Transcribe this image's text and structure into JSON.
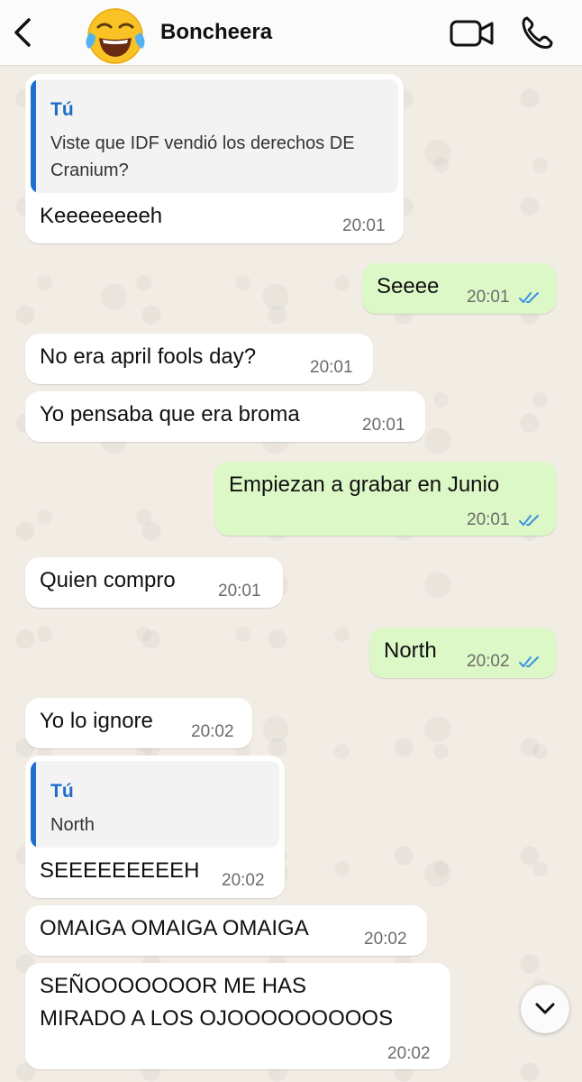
{
  "header": {
    "contact_name": "Boncheera",
    "avatar": "face-with-tears-of-joy-emoji"
  },
  "icons": {
    "back": "chevron-left-icon",
    "video": "video-camera-icon",
    "call": "phone-icon",
    "scroll_down": "chevron-down-icon",
    "read_receipt": "double-check-icon"
  },
  "colors": {
    "incoming_bubble": "#ffffff",
    "outgoing_bubble": "#dbf8c6",
    "quote_accent": "#1f6fd0",
    "read_ticks": "#3a93e6"
  },
  "messages": [
    {
      "dir": "in",
      "quote": {
        "author": "Tú",
        "text": "Viste que IDF vendió los derechos DE\nCranium?"
      },
      "text": "Keeeeeeeeh",
      "time": "20:01"
    },
    {
      "dir": "out",
      "text": "Seeee",
      "time": "20:01",
      "read": true
    },
    {
      "dir": "in",
      "text": "No era april fools day?",
      "time": "20:01"
    },
    {
      "dir": "in",
      "text": "Yo pensaba que era broma",
      "time": "20:01"
    },
    {
      "dir": "out",
      "text": "Empiezan a grabar en Junio",
      "time": "20:01",
      "read": true
    },
    {
      "dir": "in",
      "text": "Quien compro",
      "time": "20:01"
    },
    {
      "dir": "out",
      "text": "North",
      "time": "20:02",
      "read": true
    },
    {
      "dir": "in",
      "text": "Yo lo ignore",
      "time": "20:02"
    },
    {
      "dir": "in",
      "quote": {
        "author": "Tú",
        "text": "North"
      },
      "text": "SEEEEEEEEEH",
      "time": "20:02"
    },
    {
      "dir": "in",
      "text": "OMAIGA OMAIGA OMAIGA",
      "time": "20:02"
    },
    {
      "dir": "in",
      "text": "SEÑOOOOOOOR ME HAS\nMIRADO A LOS OJOOOOOOOOOS",
      "time": "20:02"
    }
  ]
}
